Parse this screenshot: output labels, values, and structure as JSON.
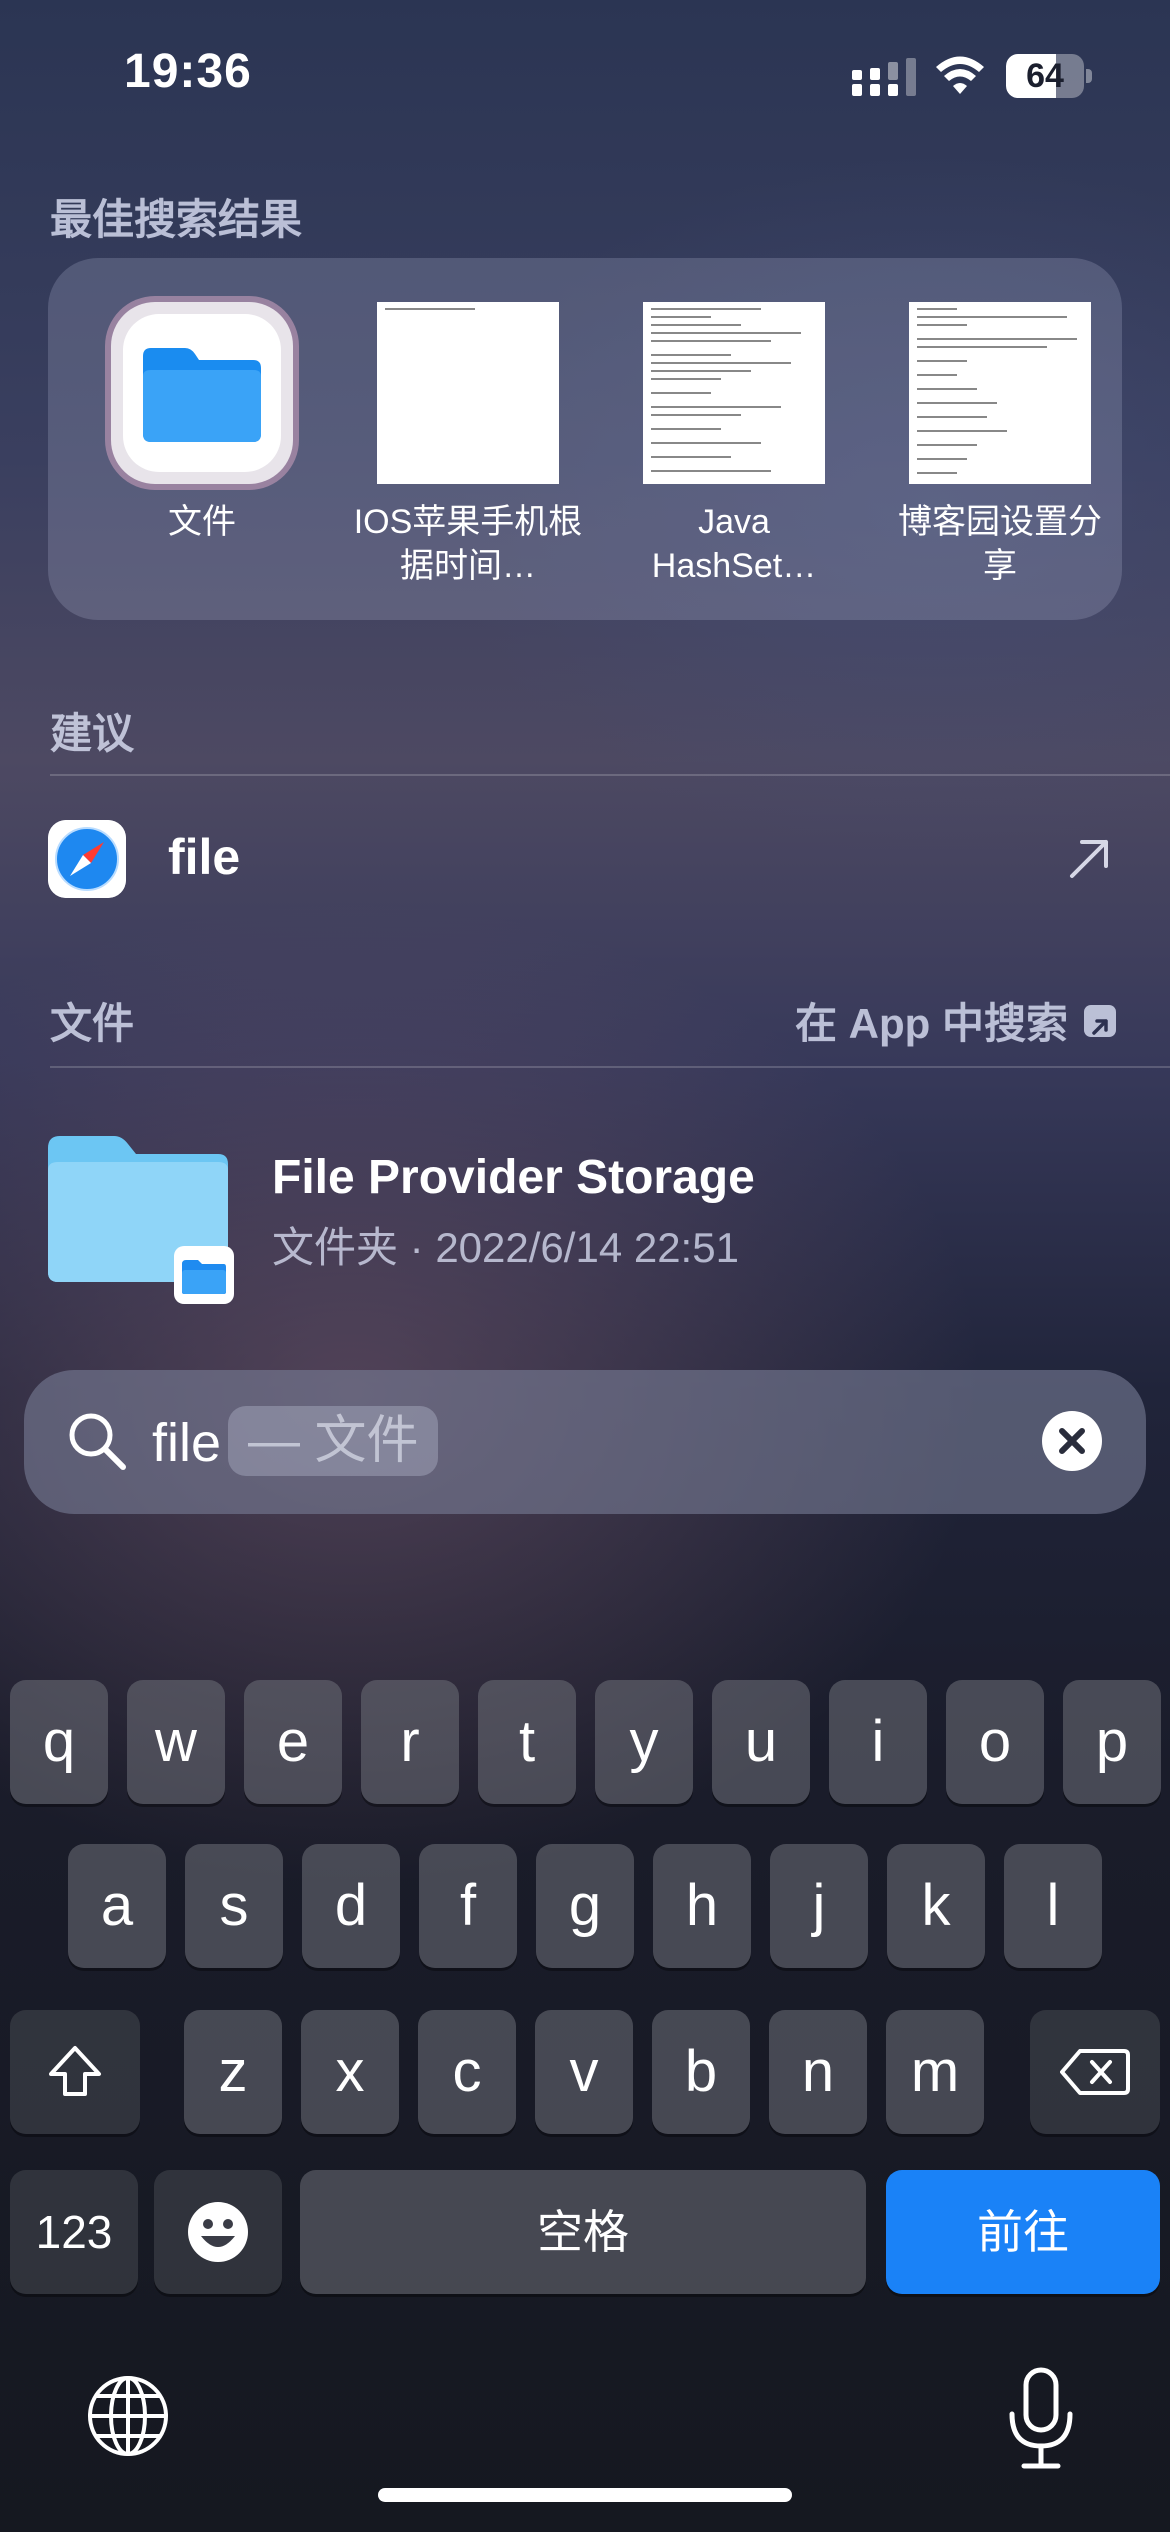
{
  "status_bar": {
    "time": "19:36",
    "battery": "64",
    "battery_level_percent": 64
  },
  "top_hits": {
    "title": "最佳搜索结果",
    "items": [
      {
        "label": "文件",
        "kind": "app",
        "icon": "files-app-icon"
      },
      {
        "label": "IOS苹果手机根据时间…",
        "kind": "document"
      },
      {
        "label": "Java HashSet…",
        "kind": "document"
      },
      {
        "label": "博客园设置分享",
        "kind": "document"
      }
    ]
  },
  "suggestions": {
    "title": "建议",
    "items": [
      {
        "text": "file",
        "icon": "safari-icon",
        "action_icon": "arrow-up-right-icon"
      }
    ]
  },
  "files_section": {
    "title": "文件",
    "search_in_app": "在 App 中搜索",
    "results": [
      {
        "title": "File Provider Storage",
        "subtitle": "文件夹 · 2022/6/14 22:51",
        "icon": "folder-icon"
      }
    ]
  },
  "search": {
    "query": "file",
    "completion": "— 文件"
  },
  "keyboard": {
    "row1": [
      "q",
      "w",
      "e",
      "r",
      "t",
      "y",
      "u",
      "i",
      "o",
      "p"
    ],
    "row2": [
      "a",
      "s",
      "d",
      "f",
      "g",
      "h",
      "j",
      "k",
      "l"
    ],
    "row3": [
      "z",
      "x",
      "c",
      "v",
      "b",
      "n",
      "m"
    ],
    "numbers_key": "123",
    "space_key": "空格",
    "go_key": "前往"
  },
  "colors": {
    "accent_blue": "#1a82f7",
    "files_blue": "#1f8bf0"
  }
}
